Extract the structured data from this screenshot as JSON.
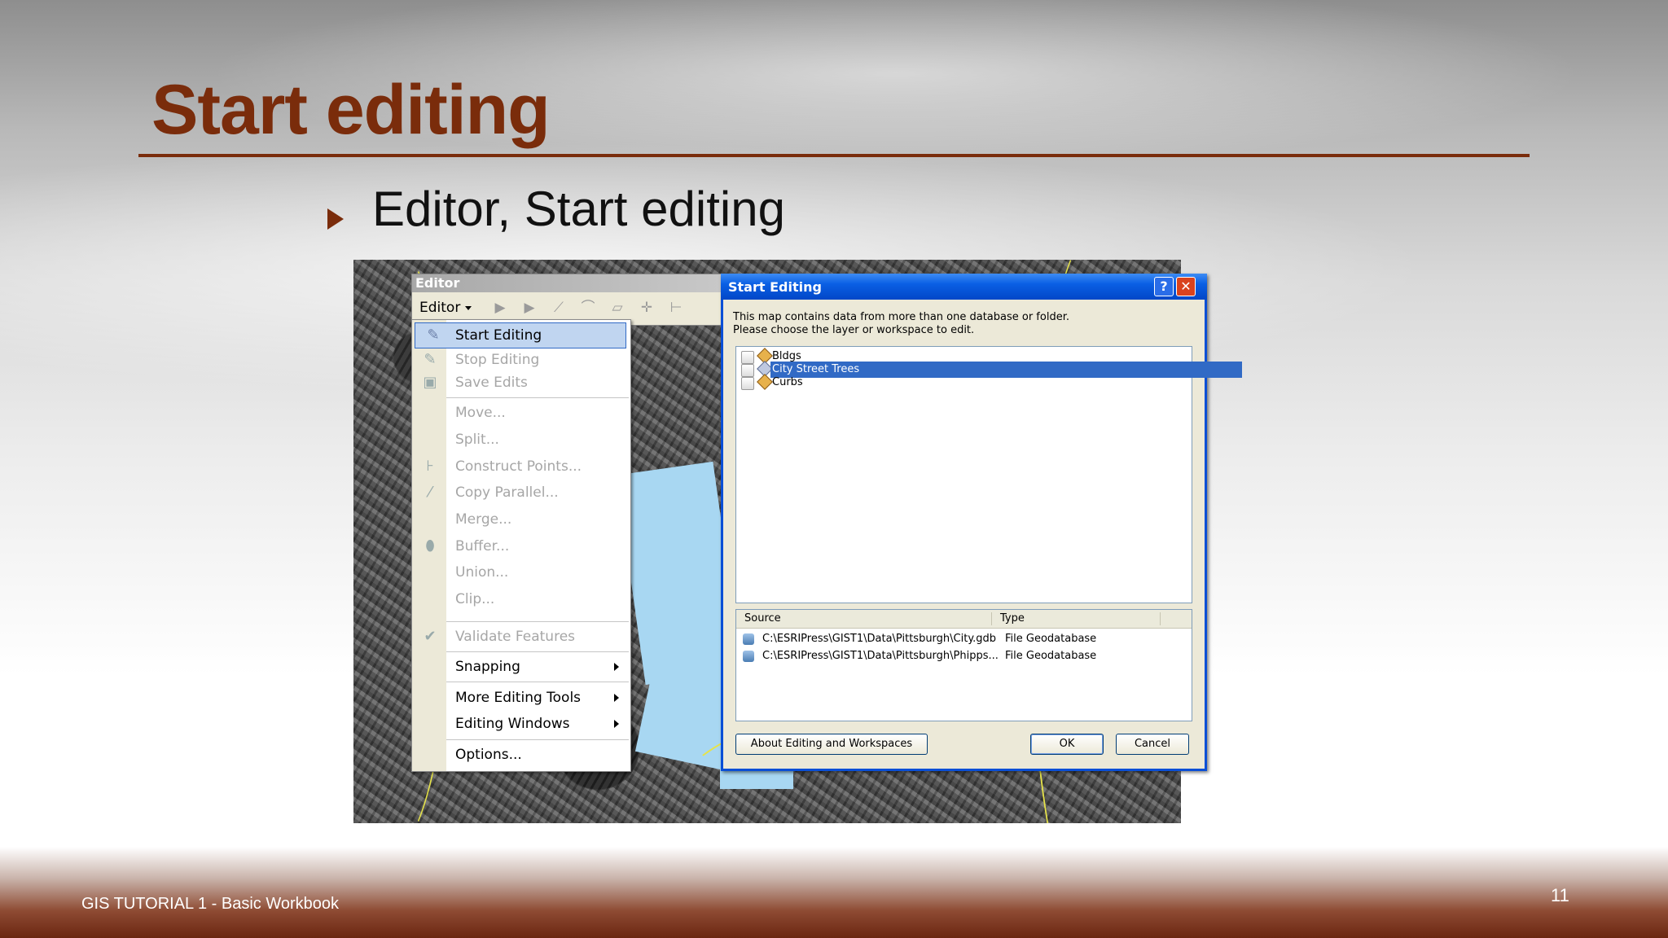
{
  "slide": {
    "title": "Start editing",
    "bullet": "Editor, Start editing",
    "footer": "GIS TUTORIAL 1 - Basic Workbook",
    "page_number": "11"
  },
  "toolbar": {
    "window_title": "Editor",
    "editor_menu_label": "Editor"
  },
  "menu": {
    "items": [
      {
        "label": "Start Editing",
        "enabled": true,
        "icon": "pencil-icon"
      },
      {
        "label": "Stop Editing",
        "enabled": false,
        "icon": "stop-pencil-icon"
      },
      {
        "label": "Save Edits",
        "enabled": false,
        "icon": "save-icon"
      },
      {
        "label": "Move...",
        "enabled": false
      },
      {
        "label": "Split...",
        "enabled": false
      },
      {
        "label": "Construct Points...",
        "enabled": false,
        "icon": "construct-points-icon"
      },
      {
        "label": "Copy Parallel...",
        "enabled": false,
        "icon": "copy-parallel-icon"
      },
      {
        "label": "Merge...",
        "enabled": false
      },
      {
        "label": "Buffer...",
        "enabled": false,
        "icon": "buffer-icon"
      },
      {
        "label": "Union...",
        "enabled": false
      },
      {
        "label": "Clip...",
        "enabled": false
      },
      {
        "label": "Validate Features",
        "enabled": false,
        "icon": "validate-icon"
      },
      {
        "label": "Snapping",
        "enabled": true,
        "submenu": true
      },
      {
        "label": "More Editing Tools",
        "enabled": true,
        "submenu": true
      },
      {
        "label": "Editing Windows",
        "enabled": true,
        "submenu": true
      },
      {
        "label": "Options...",
        "enabled": true
      }
    ]
  },
  "dialog": {
    "title": "Start Editing",
    "help_glyph": "?",
    "close_glyph": "✕",
    "message_line1": "This map contains data from more than one database or folder.",
    "message_line2": "Please choose the layer or workspace to edit.",
    "layers": [
      {
        "name": "Bldgs",
        "selected": false
      },
      {
        "name": "City Street Trees",
        "selected": true
      },
      {
        "name": "Curbs",
        "selected": false
      }
    ],
    "columns": {
      "source": "Source",
      "type": "Type"
    },
    "sources": [
      {
        "path": "C:\\ESRIPress\\GIST1\\Data\\Pittsburgh\\City.gdb",
        "type": "File Geodatabase"
      },
      {
        "path": "C:\\ESRIPress\\GIST1\\Data\\Pittsburgh\\Phipps...",
        "type": "File Geodatabase"
      }
    ],
    "about_button": "About Editing and Workspaces",
    "ok_button": "OK",
    "cancel_button": "Cancel"
  }
}
